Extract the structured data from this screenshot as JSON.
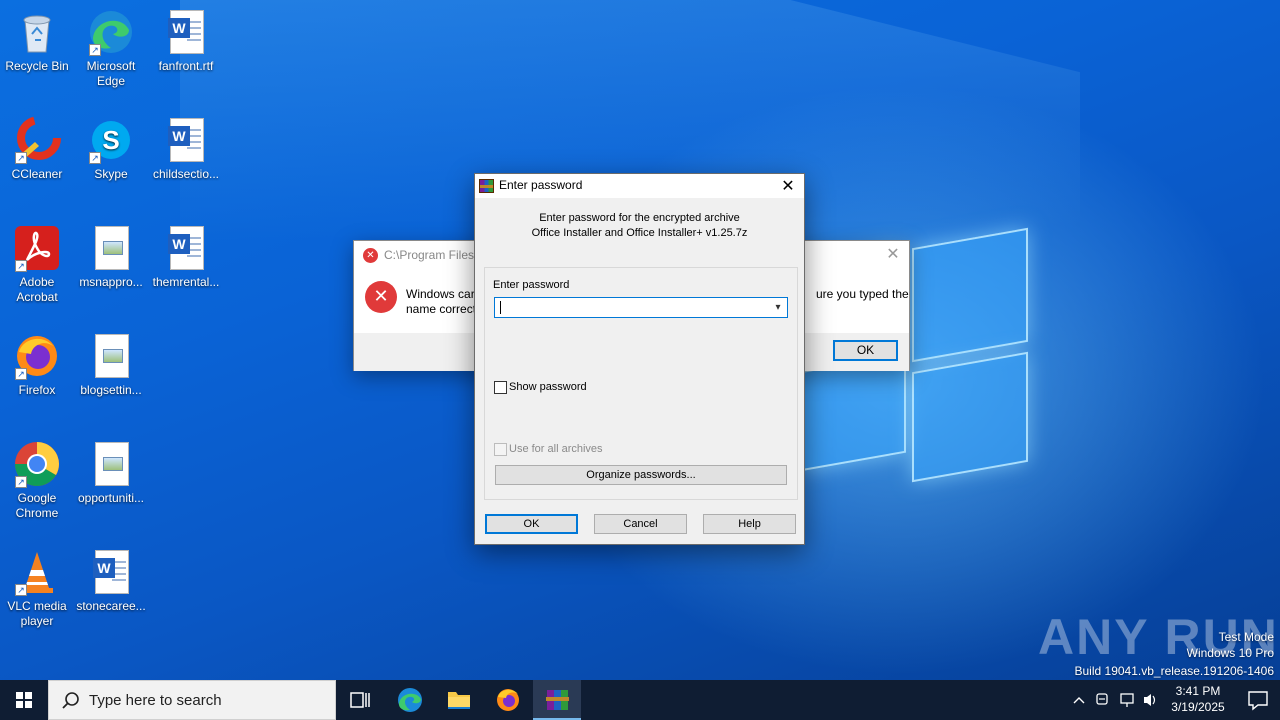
{
  "desktop_icons": {
    "recycle_bin": "Recycle Bin",
    "edge": "Microsoft Edge",
    "fanfront": "fanfront.rtf",
    "ccleaner": "CCleaner",
    "skype": "Skype",
    "childsection": "childsectio...",
    "adobe": "Adobe Acrobat",
    "msnapp": "msnappro...",
    "themrental": "themrental...",
    "firefox": "Firefox",
    "blogsetting": "blogsettin...",
    "chrome": "Google Chrome",
    "opportunity": "opportuniti...",
    "vlc": "VLC media player",
    "stonecareer": "stonecaree..."
  },
  "error_dialog": {
    "title": "C:\\Program Files",
    "message_line1": "Windows car",
    "message_line2": "name correct",
    "message_right": "ure you typed the",
    "ok_label": "OK"
  },
  "password_dialog": {
    "title": "Enter password",
    "info_line1": "Enter password for the encrypted archive",
    "info_line2": "Office Installer and Office Installer+ v1.25.7z",
    "password_label": "Enter password",
    "password_value": "",
    "show_password_label": "Show password",
    "use_for_all_label": "Use for all archives",
    "organize_label": "Organize passwords...",
    "ok_label": "OK",
    "cancel_label": "Cancel",
    "help_label": "Help"
  },
  "watermark": {
    "brand": "ANY RUN",
    "line1": "Test Mode",
    "line2": "Windows 10 Pro",
    "line3": "Build 19041.vb_release.191206-1406"
  },
  "taskbar": {
    "search_placeholder": "Type here to search",
    "time": "3:41 PM",
    "date": "3/19/2025"
  }
}
